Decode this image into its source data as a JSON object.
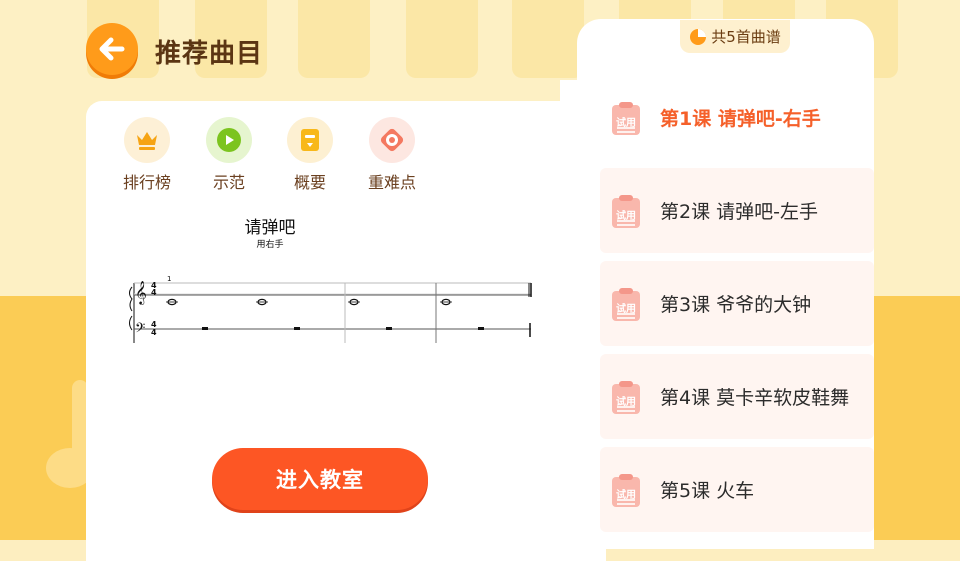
{
  "header": {
    "title": "推荐曲目",
    "back_icon": "arrow-left-icon"
  },
  "tools": [
    {
      "label": "排行榜",
      "icon": "crown-icon",
      "color": "#f6a414"
    },
    {
      "label": "示范",
      "icon": "play-icon",
      "color": "#7cc41f"
    },
    {
      "label": "概要",
      "icon": "document-icon",
      "color": "#f8b81a"
    },
    {
      "label": "重难点",
      "icon": "target-icon",
      "color": "#f47961"
    }
  ],
  "score": {
    "title": "请弹吧",
    "subtitle": "用右手",
    "measure_number": "1",
    "time_signature": "4/4"
  },
  "enter_button": "进入教室",
  "playlist": {
    "count_label": "共5首曲谱",
    "trial_label": "试用",
    "lessons": [
      {
        "label": "第1课 请弹吧-右手",
        "active": true
      },
      {
        "label": "第2课 请弹吧-左手",
        "active": false
      },
      {
        "label": "第3课 爷爷的大钟",
        "active": false
      },
      {
        "label": "第4课 莫卡辛软皮鞋舞",
        "active": false
      },
      {
        "label": "第5课 火车",
        "active": false
      }
    ]
  },
  "colors": {
    "accent": "#fd5624",
    "brand_orange": "#ff9b1a",
    "active_text": "#f5602a"
  }
}
